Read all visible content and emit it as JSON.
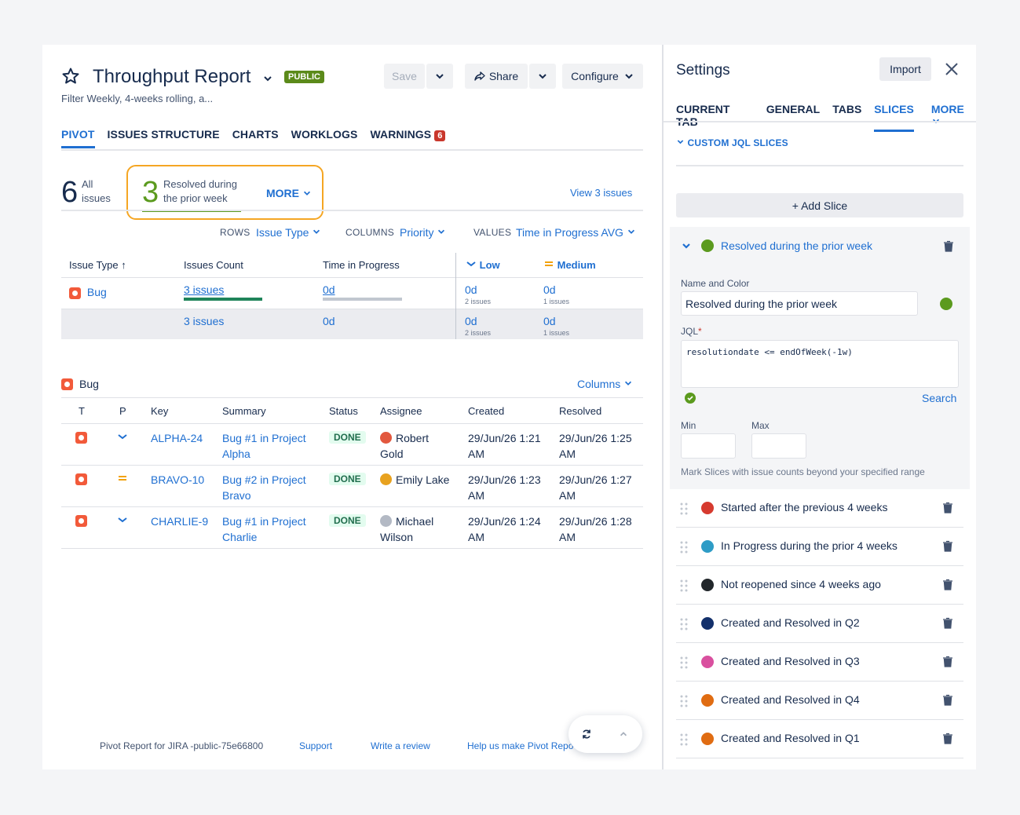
{
  "report": {
    "title": "Throughput Report",
    "visibility_badge": "PUBLIC",
    "subtitle": "Filter Weekly, 4-weeks rolling, a...",
    "save_label": "Save",
    "share_label": "Share",
    "configure_label": "Configure"
  },
  "tabs": [
    {
      "label": "PIVOT",
      "active": true
    },
    {
      "label": "ISSUES STRUCTURE"
    },
    {
      "label": "CHARTS"
    },
    {
      "label": "WORKLOGS"
    },
    {
      "label": "WARNINGS",
      "badge": "6"
    }
  ],
  "stats": {
    "all_count": "6",
    "all_label": "All issues",
    "slice_count": "3",
    "slice_label": "Resolved during the prior week",
    "more_label": "MORE",
    "view_link": "View 3 issues"
  },
  "controls": {
    "rows_label": "ROWS",
    "rows_value": "Issue Type",
    "columns_label": "COLUMNS",
    "columns_value": "Priority",
    "values_label": "VALUES",
    "values_value": "Time in Progress AVG"
  },
  "pivot": {
    "headers": {
      "issue_type": "Issue Type",
      "issues_count": "Issues Count",
      "time_in_progress": "Time in Progress",
      "low": "Low",
      "medium": "Medium"
    },
    "row": {
      "type": "Bug",
      "count": "3 issues",
      "time": "0d",
      "low_time": "0d",
      "low_sub": "2 issues",
      "medium_time": "0d",
      "medium_sub": "1 issues"
    },
    "total": {
      "count": "3 issues",
      "time": "0d",
      "low_time": "0d",
      "low_sub": "2 issues",
      "medium_time": "0d",
      "medium_sub": "1 issues"
    }
  },
  "issues": {
    "group_title": "Bug",
    "columns_link": "Columns",
    "headers": {
      "t": "T",
      "p": "P",
      "key": "Key",
      "summary": "Summary",
      "status": "Status",
      "assignee": "Assignee",
      "created": "Created",
      "resolved": "Resolved"
    },
    "rows": [
      {
        "key": "ALPHA-24",
        "priority": "low",
        "summary_1": "Bug #1 in Project",
        "summary_2": "Alpha",
        "status": "DONE",
        "assignee_1": "Robert",
        "assignee_2": "Gold",
        "created_1": "29/Jun/26 1:21",
        "created_2": "AM",
        "resolved_1": "29/Jun/26 1:25",
        "resolved_2": "AM",
        "avatar_color": "#e2583e"
      },
      {
        "key": "BRAVO-10",
        "priority": "medium",
        "summary_1": "Bug #2 in Project",
        "summary_2": "Bravo",
        "status": "DONE",
        "assignee_1": "Emily Lake",
        "assignee_2": "",
        "created_1": "29/Jun/26 1:23",
        "created_2": "AM",
        "resolved_1": "29/Jun/26 1:27",
        "resolved_2": "AM",
        "avatar_color": "#e8a21f"
      },
      {
        "key": "CHARLIE-9",
        "priority": "low",
        "summary_1": "Bug #1 in Project",
        "summary_2": "Charlie",
        "status": "DONE",
        "assignee_1": "Michael",
        "assignee_2": "Wilson",
        "created_1": "29/Jun/26 1:24",
        "created_2": "AM",
        "resolved_1": "29/Jun/26 1:28",
        "resolved_2": "AM",
        "avatar_color": "#b3b9c4"
      }
    ]
  },
  "footer": {
    "version": "Pivot Report for JIRA -public-75e66800",
    "support": "Support",
    "review": "Write a review",
    "help": "Help us make Pivot Repor"
  },
  "settings": {
    "title": "Settings",
    "import_label": "Import",
    "tabs": [
      {
        "label": "CURRENT TAB"
      },
      {
        "label": "GENERAL"
      },
      {
        "label": "TABS"
      },
      {
        "label": "SLICES",
        "active": true
      },
      {
        "label": "MORE"
      }
    ],
    "section_title": "CUSTOM JQL SLICES",
    "add_slice": "+ Add Slice",
    "expanded": {
      "title": "Resolved during the prior week",
      "color": "#5b9a1e",
      "name_color_label": "Name and Color",
      "name_value": "Resolved during the prior week",
      "jql_label": "JQL",
      "jql_value": "resolutiondate <= endOfWeek(-1w)",
      "search_label": "Search",
      "min_label": "Min",
      "max_label": "Max",
      "hint": "Mark Slices with issue counts beyond your specified range"
    },
    "slices": [
      {
        "label": "Started after the previous 4 weeks",
        "color": "#d63a2f"
      },
      {
        "label": "In Progress during the prior 4 weeks",
        "color": "#2e9cc6"
      },
      {
        "label": "Not reopened since 4 weeks ago",
        "color": "#22272b"
      },
      {
        "label": "Created and Resolved in Q2",
        "color": "#13306b"
      },
      {
        "label": "Created and Resolved in Q3",
        "color": "#d9509f"
      },
      {
        "label": "Created and Resolved in Q4",
        "color": "#e06c12"
      },
      {
        "label": "Created and Resolved in Q1",
        "color": "#e06c12"
      }
    ]
  }
}
